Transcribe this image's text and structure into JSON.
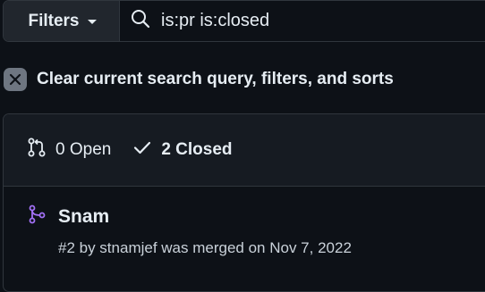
{
  "search": {
    "filters_label": "Filters",
    "query": "is:pr is:closed"
  },
  "clear": {
    "label": "Clear current search query, filters, and sorts"
  },
  "states": {
    "open_label": "0 Open",
    "closed_label": "2 Closed"
  },
  "pull_requests": [
    {
      "title": "Snam",
      "meta": "#2 by stnamjef was merged on Nov 7, 2022",
      "status": "merged"
    }
  ],
  "colors": {
    "background": "#0d1117",
    "border": "#30363d",
    "merged_purple": "#a371f7"
  }
}
